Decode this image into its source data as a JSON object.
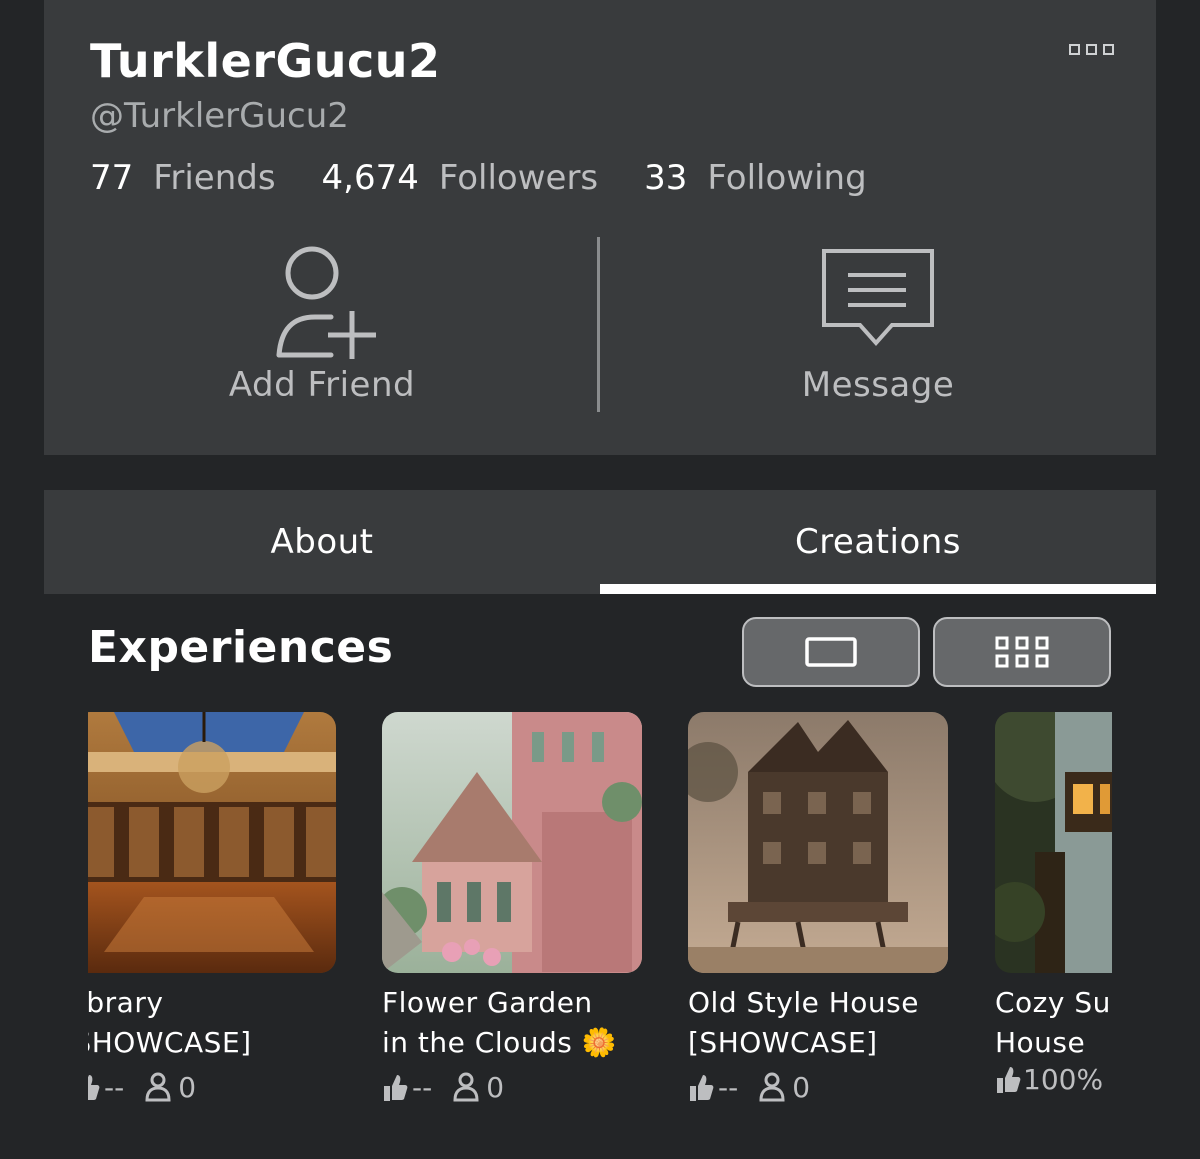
{
  "profile": {
    "display_name": "TurklerGucu2",
    "username": "@TurklerGucu2",
    "stats": [
      {
        "value": "77",
        "label": "Friends"
      },
      {
        "value": "4,674",
        "label": "Followers"
      },
      {
        "value": "33",
        "label": "Following"
      }
    ],
    "actions": {
      "add_friend": "Add Friend",
      "message": "Message"
    }
  },
  "tabs": [
    {
      "label": "About",
      "active": false
    },
    {
      "label": "Creations",
      "active": true
    }
  ],
  "experiences": {
    "title": "Experiences",
    "view_mode": "grid",
    "items": [
      {
        "title_line1": "Library",
        "title_line2": "[SHOWCASE]",
        "rating": "--",
        "players": "0"
      },
      {
        "title_line1": "Flower Garden",
        "title_line2": "in the Clouds 🌼",
        "rating": "--",
        "players": "0"
      },
      {
        "title_line1": "Old Style House",
        "title_line2": "[SHOWCASE]",
        "rating": "--",
        "players": "0"
      },
      {
        "title_line1": "Cozy Su",
        "title_line2": "House",
        "rating": "100%",
        "players": ""
      }
    ]
  },
  "colors": {
    "background": "#232527",
    "card": "#393b3d",
    "text": "#ffffff",
    "muted": "#bdbec0"
  }
}
